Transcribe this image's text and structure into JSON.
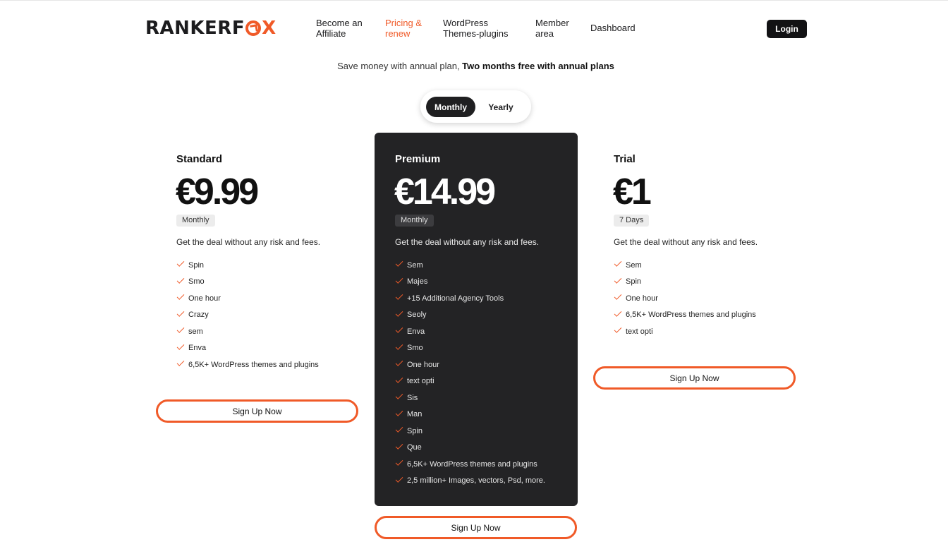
{
  "header": {
    "logo_text_main": "RANKERF",
    "logo_text_end": "X",
    "nav": [
      {
        "label": "Become an Affiliate"
      },
      {
        "label": "Pricing & renew"
      },
      {
        "label": "WordPress Themes-plugins"
      },
      {
        "label": "Member area"
      },
      {
        "label": "Dashboard"
      }
    ],
    "login_label": "Login"
  },
  "subtitle": {
    "plain": "Save money with annual plan, ",
    "bold": "Two months free with annual plans"
  },
  "billing_toggle": {
    "monthly": "Monthly",
    "yearly": "Yearly",
    "selected": "Monthly"
  },
  "plans": [
    {
      "name": "Standard",
      "price": "€9.99",
      "period": "Monthly",
      "description": "Get the deal without any risk and fees.",
      "features": [
        "Spin",
        "Smo",
        "One hour",
        "Crazy",
        "sem",
        "Enva",
        "6,5K+ WordPress themes and plugins"
      ],
      "cta": "Sign Up Now"
    },
    {
      "name": "Premium",
      "price": "€14.99",
      "period": "Monthly",
      "description": "Get the deal without any risk and fees.",
      "features": [
        "Sem",
        "Majes",
        "+15 Additional Agency Tools",
        "Seoly",
        "Enva",
        "Smo",
        "One hour",
        "text opti",
        "Sis",
        "Man",
        "Spin",
        "Que",
        "6,5K+ WordPress themes and plugins",
        "2,5 million+ Images, vectors, Psd, more."
      ],
      "cta": "Sign Up Now"
    },
    {
      "name": "Trial",
      "price": "€1",
      "period": "7 Days",
      "description": "Get the deal without any risk and fees.",
      "features": [
        "Sem",
        "Spin",
        "One hour",
        "6,5K+ WordPress themes and plugins",
        "text opti"
      ],
      "cta": "Sign Up Now"
    }
  ],
  "colors": {
    "accent": "#f05a28",
    "dark": "#232325",
    "login_bg": "#121214"
  },
  "icons": {
    "feature_check": "check-icon",
    "logo_mark": "fox-logo-icon"
  }
}
